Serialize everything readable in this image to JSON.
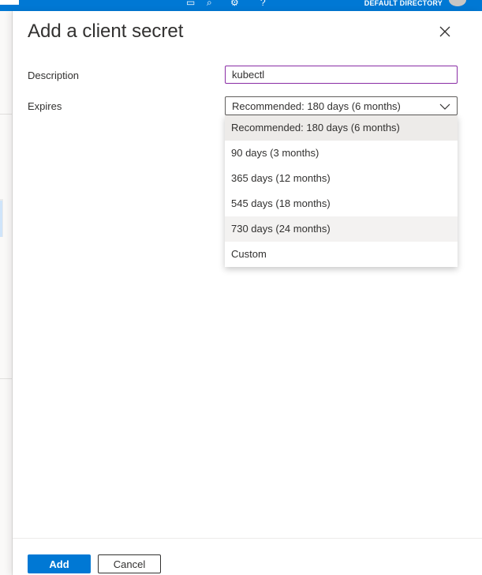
{
  "topbar": {
    "directory": "DEFAULT DIRECTORY",
    "icons": [
      "notifications-icon",
      "feedback-icon",
      "settings-icon",
      "help-icon"
    ]
  },
  "panel": {
    "title": "Add a client secret",
    "close_icon": "close-icon"
  },
  "description": {
    "label": "Description",
    "value": "kubectl"
  },
  "expires": {
    "label": "Expires",
    "selected": "Recommended: 180 days (6 months)",
    "options": [
      "Recommended: 180 days (6 months)",
      "90 days (3 months)",
      "365 days (12 months)",
      "545 days (18 months)",
      "730 days (24 months)",
      "Custom"
    ],
    "highlighted_option": "730 days (24 months)"
  },
  "footer": {
    "add_label": "Add",
    "cancel_label": "Cancel"
  },
  "colors": {
    "accent": "#0078d4",
    "focus_border": "#8a2da5"
  }
}
